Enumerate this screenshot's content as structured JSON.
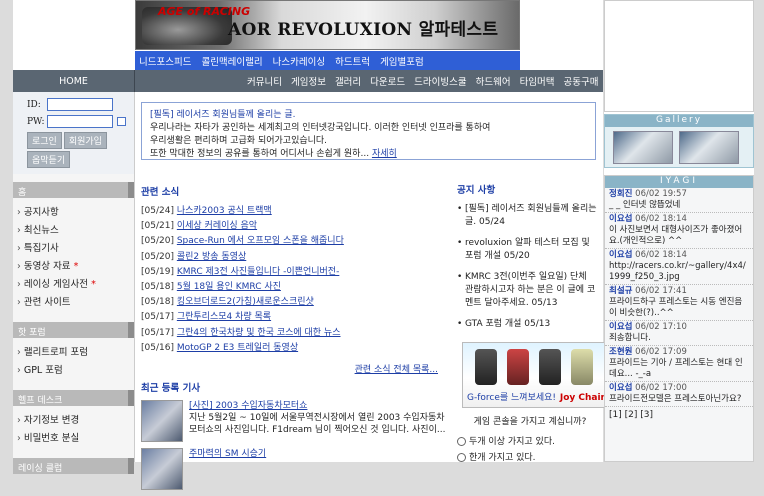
{
  "banner": {
    "title": "AOR REVOLUXION 알파테스트",
    "car_text": "AGE of RACING"
  },
  "bluebar": [
    "니드포스피드",
    "콜린맥레이랠리",
    "나스카레이싱",
    "하드트럭",
    "게임별포럼"
  ],
  "nav": {
    "home": "HOME",
    "items": [
      "커뮤니티",
      "게임정보",
      "갤러리",
      "다운로드",
      "드라이빙스쿨",
      "하드웨어",
      "타임머택",
      "공동구매"
    ]
  },
  "login": {
    "id_label": "ID:",
    "pw_label": "PW:",
    "buttons": [
      "로그인",
      "회원가입",
      "옵막듣기"
    ]
  },
  "left": {
    "sec1": "홈",
    "links1": [
      {
        "t": "공지사항"
      },
      {
        "t": "최신뉴스"
      },
      {
        "t": "특집기사"
      },
      {
        "t": "동영상 자료",
        "star": "*"
      },
      {
        "t": "레이싱 게임사전",
        "star": "*"
      },
      {
        "t": "관련 사이트"
      }
    ],
    "sec2": "핫 포럼",
    "links2": [
      {
        "t": "랠리트로피 포럼"
      },
      {
        "t": "GPL 포럼"
      }
    ],
    "sec3": "헬프 데스크",
    "links3": [
      {
        "t": "자기정보 변경"
      },
      {
        "t": "비밀번호 분실"
      }
    ],
    "sec4": "레이싱 클럽"
  },
  "notice": {
    "head": "[필독] 레이서즈 회원님들께 올리는 글.",
    "lines": [
      "우리나라는 자타가 공인하는 세계최고의 인터넷강국입니다. 이러한 인터넷 인프라를 통하여",
      "우리생활은 편리하며 고급화 되어가고있습니다.",
      "또한 막대한 정보의 공유를 통하여 어디서나 손쉽게 원하..."
    ],
    "detail": "자세히"
  },
  "news": {
    "title": "관련 소식",
    "items": [
      {
        "d": "[05/24]",
        "t": "나스카2003 공식 트랙맥"
      },
      {
        "d": "[05/21]",
        "t": "이세상 커레이싱 음악"
      },
      {
        "d": "[05/20]",
        "t": "Space-Run 에서 오프모임 스폰을 해줍니다"
      },
      {
        "d": "[05/20]",
        "t": "콜린2 방송 동영상"
      },
      {
        "d": "[05/19]",
        "t": "KMRC 제3전 사진들입니다 -이쁜언니버전-"
      },
      {
        "d": "[05/18]",
        "t": "5월 18일 용인 KMRC 사진"
      },
      {
        "d": "[05/18]",
        "t": "킹오브더로드2(가칭)새로운스크린샷"
      },
      {
        "d": "[05/17]",
        "t": "그란투리스모4 차량 목록"
      },
      {
        "d": "[05/17]",
        "t": "그란4의 한국차량 및 한국 코스에 대한 뉴스"
      },
      {
        "d": "[05/16]",
        "t": "MotoGP 2 E3 트레일러 동영상"
      }
    ],
    "more": "관련 소식 전체 목록..."
  },
  "recent": {
    "title": "최근 등록 기사",
    "items": [
      {
        "link": "[사진] 2003 수입자동차모터쇼",
        "desc": "지난 5월2일 ~ 10일에 서울무역전시장에서 열린 2003 수입자동차모터쇼의 사진입니다. F1dream 님이 찍어오신 것 입니다. 사진이..."
      },
      {
        "link": "주마력의 SM 시승기",
        "desc": ""
      }
    ]
  },
  "notice2": {
    "title": "공지 사항",
    "items": [
      "[필독] 레이서즈 회원님들께 올리는 글. 05/24",
      "revoluxion 알파 테스터 모집 및 포럼 개설 05/20",
      "KMRC 3전(이번주 일요일) 단체 관람하시고자 하는 분은 이 글에 코멘트 달아주세요. 05/13",
      "GTA 포럼 개설 05/13"
    ]
  },
  "ad": {
    "gforce": "G-force를 느껴보세요!",
    "joy": "Joy Chair"
  },
  "poll": {
    "q": "게임 콘솔을 가지고 계십니까?",
    "options": [
      "두개 이상 가지고 있다.",
      "한개 가지고 있다."
    ]
  },
  "gallery": {
    "title": "Gallery"
  },
  "iyagi": {
    "title": "IYAGI",
    "comments": [
      {
        "n": "정회진",
        "d": "06/02 19:57",
        "t": "_ _ 인터넷 않뜹었네"
      },
      {
        "n": "이요섭",
        "d": "06/02 18:14",
        "t": "이 사진보면서 대형사이즈가 좋아졌어요.(개인적으로) ^^"
      },
      {
        "n": "이요섭",
        "d": "06/02 18:14",
        "t": "http://racers.co.kr/~gallery/4x4/1999_f250_3.jpg"
      },
      {
        "n": "최설규",
        "d": "06/02 17:41",
        "t": "프라이드하구 프레스토는 시동 엔진음이 비슷한(?)..^^"
      },
      {
        "n": "이요섭",
        "d": "06/02 17:10",
        "t": "죄송합니다."
      },
      {
        "n": "조현원",
        "d": "06/02 17:09",
        "t": "프라이드는 기아 / 프레스토는 현대 인데요... -_-a"
      },
      {
        "n": "이요섭",
        "d": "06/02 17:00",
        "t": "프라이드전모델은 프레스토아닌가요?"
      }
    ],
    "pager": "[1] [2] [3]"
  }
}
